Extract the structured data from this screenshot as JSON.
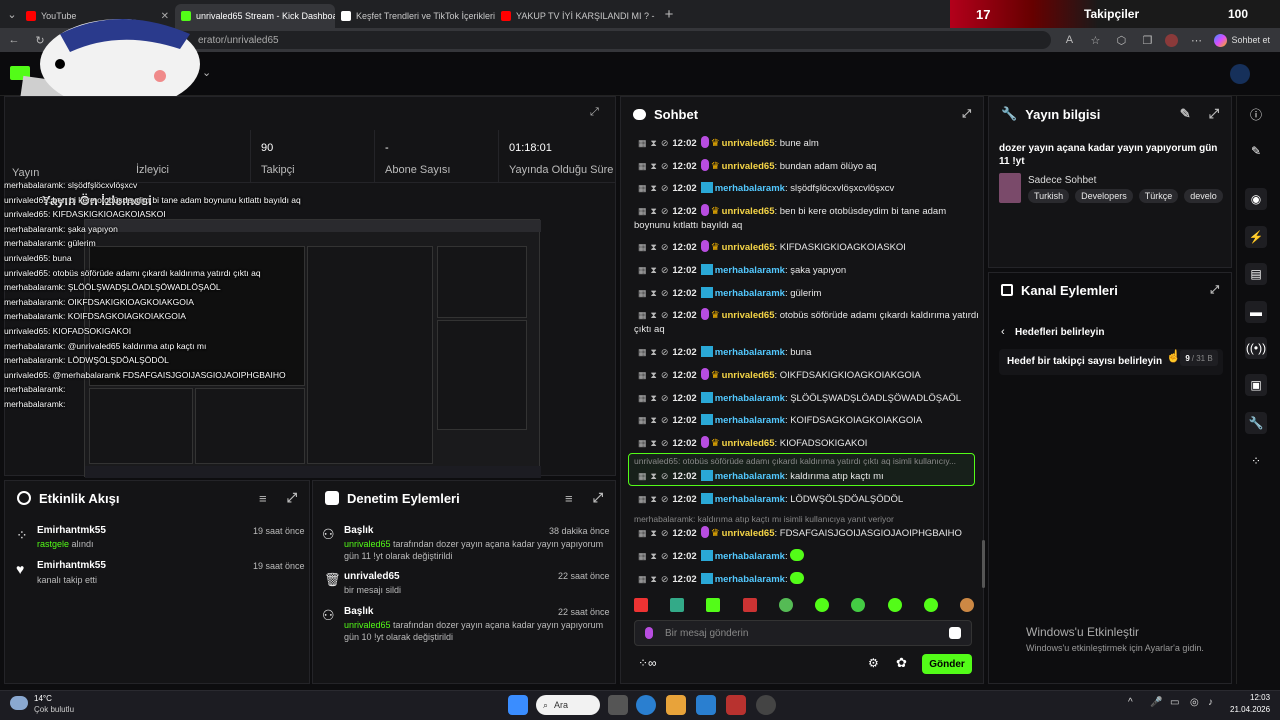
{
  "browser": {
    "tabs": [
      {
        "label": "YouTube",
        "color": "#ff0000",
        "active": false
      },
      {
        "label": "unrivaled65 Stream - Kick Dashboard",
        "color": "#53fc18",
        "active": true
      },
      {
        "label": "Keşfet Trendleri ve TikTok İçerikleri",
        "color": "#ffffff",
        "active": false
      },
      {
        "label": "YAKUP TV İYİ KARŞILANDI MI ? - Yo",
        "color": "#ff0000",
        "active": false
      }
    ],
    "url": "erator/unrivaled65",
    "profile_label": "Sohbet et"
  },
  "overlay": {
    "count": "17",
    "label": "Takipçiler",
    "goal": "100"
  },
  "stream": {
    "title_label": "Yayın",
    "stats": [
      {
        "value": "90",
        "label": "Takipçi"
      },
      {
        "value": "-",
        "label": "Abone Sayısı"
      },
      {
        "value": "01:18:01",
        "label": "Yayında Olduğu Süre"
      }
    ],
    "viewers_label": "İzleyici",
    "preview_title": "Yayın Ön İzlemesi"
  },
  "chat": {
    "title": "Sohbet",
    "placeholder": "Bir mesaj gönderin",
    "send_label": "Gönder",
    "messages": [
      {
        "time": "12:02",
        "user": "unrivaled65",
        "type": "u1",
        "text": "bune alm"
      },
      {
        "time": "12:02",
        "user": "unrivaled65",
        "type": "u1",
        "text": "bundan adam ölüyo aq"
      },
      {
        "time": "12:02",
        "user": "merhabalaramk",
        "type": "u2",
        "text": "slşödfşlöcxvlöşxcvlöşxcv"
      },
      {
        "time": "12:02",
        "user": "unrivaled65",
        "type": "u1",
        "text": "ben bi kere otobüsdeydim bi tane adam boynunu kıtlattı bayıldı aq"
      },
      {
        "time": "12:02",
        "user": "unrivaled65",
        "type": "u1",
        "text": "KIFDASKIGKIOAGKOIASKOI"
      },
      {
        "time": "12:02",
        "user": "merhabalaramk",
        "type": "u2",
        "text": "şaka yapıyon"
      },
      {
        "time": "12:02",
        "user": "merhabalaramk",
        "type": "u2",
        "text": "gülerim"
      },
      {
        "time": "12:02",
        "user": "unrivaled65",
        "type": "u1",
        "text": "otobüs söförüde adamı çıkardı kaldırıma yatırdı çıktı aq"
      },
      {
        "time": "12:02",
        "user": "merhabalaramk",
        "type": "u2",
        "text": "buna"
      },
      {
        "time": "12:02",
        "user": "unrivaled65",
        "type": "u1",
        "text": "OIKFDSAKIGKIOAGKOIAKGOIA"
      },
      {
        "time": "12:02",
        "user": "merhabalaramk",
        "type": "u2",
        "text": "ŞLÖÖLŞWADŞLÖADLŞÖWADLÖŞAÖL"
      },
      {
        "time": "12:02",
        "user": "merhabalaramk",
        "type": "u2",
        "text": "KOIFDSAGKOIAGKOIAKGOIA"
      },
      {
        "time": "12:02",
        "user": "unrivaled65",
        "type": "u1",
        "text": "KIOFADSOKIGAKOI"
      }
    ],
    "reply1": "unrivaled65: otobüs söförüde adamı çıkardı kaldırıma yatırdı çıktı aq isimli kullanıcıy...",
    "reply1_msg": {
      "time": "12:02",
      "user": "merhabalaramk",
      "text": "kaldırıma atıp kaçtı mı"
    },
    "msg_after": {
      "time": "12:02",
      "user": "merhabalaramk",
      "text": "LÖDWŞÖLŞDÖALŞÖDÖL"
    },
    "reply2": "merhabalaramk: kaldırıma atıp kaçtı mı isimli kullanıcıya yanıt veriyor",
    "reply2_msg": {
      "time": "12:02",
      "user": "unrivaled65",
      "text": "FDSAFGAISJGOIJASGIOJAOIPHGBAIHO"
    },
    "emote_msgs": [
      {
        "time": "12:02",
        "user": "merhabalaramk"
      },
      {
        "time": "12:02",
        "user": "merhabalaramk"
      }
    ]
  },
  "info": {
    "title": "Yayın bilgisi",
    "stream_title": "dozer yayın açana kadar yayın yapıyorum gün 11 !yt",
    "category": "Sadece Sohbet",
    "tags": [
      "Turkish",
      "Developers",
      "Türkçe",
      "develo"
    ]
  },
  "channel_actions": {
    "title": "Kanal Eylemleri",
    "back_label": "Hedefleri belirleyin",
    "goal_label": "Hedef bir takipçi sayısı belirleyin",
    "goal_current": "9",
    "goal_max": "/ 31 B"
  },
  "activity": {
    "title": "Etkinlik Akışı",
    "items": [
      {
        "name": "Emirhantmk55",
        "time": "19 saat önce",
        "highlight": "rastgele",
        "text": " alındı"
      },
      {
        "name": "Emirhantmk55",
        "time": "19 saat önce",
        "highlight": "",
        "text": "kanalı takip etti"
      }
    ]
  },
  "moderation": {
    "title": "Denetim Eylemleri",
    "items": [
      {
        "title": "Başlık",
        "time": "38 dakika önce",
        "actor": "unrivaled65",
        "text": " tarafından dozer yayın açana kadar yayın yapıyorum gün 11 !yt olarak değiştirildi"
      },
      {
        "title": "unrivaled65",
        "time": "22 saat önce",
        "actor": "",
        "text": "bir mesajı sildi"
      },
      {
        "title": "Başlık",
        "time": "22 saat önce",
        "actor": "unrivaled65",
        "text": " tarafından dozer yayın açana kadar yayın yapıyorum gün 10 !yt olarak değiştirildi"
      }
    ]
  },
  "overlay_chat": [
    "merhabalaramk: slşödfşlöcxvlöşxcv",
    "unrivaled65: ben bi kere otobüsdeydim bi tane adam boynunu kıtlattı bayıldı aq",
    "unrivaled65: KIFDASKIGKIOAGKOIASKOI",
    "merhabalaramk: şaka yapıyon",
    "merhabalaramk: gülerim",
    "unrivaled65: buna",
    "unrivaled65: otobüs söförüde adamı çıkardı kaldırıma yatırdı çıktı aq",
    "merhabalaramk: ŞLÖÖLŞWADŞLÖADLŞÖWADLÖŞAÖL",
    "merhabalaramk: OIKFDSAKIGKIOAGKOIAKGOIA",
    "merhabalaramk: KOIFDSAGKOIAGKOIAKGOIA",
    "unrivaled65: KIOFADSOKIGAKOI",
    "merhabalaramk: @unrivaled65 kaldırıma atıp kaçtı mı",
    "merhabalaramk: LÖDWŞÖLŞDÖALŞÖDÖL",
    "unrivaled65: @merhabalaramk FDSAFGAISJGOIJASGIOJAOIPHGBAIHO",
    "merhabalaramk:",
    "merhabalaramk:"
  ],
  "windows": {
    "activate_title": "Windows'u Etkinleştir",
    "activate_sub": "Windows'u etkinleştirmek için Ayarlar'a gidin."
  },
  "taskbar": {
    "weather_temp": "14°C",
    "weather_desc": "Çok bulutlu",
    "search_label": "Ara",
    "time": "12:03",
    "date": "21.04.2026"
  }
}
